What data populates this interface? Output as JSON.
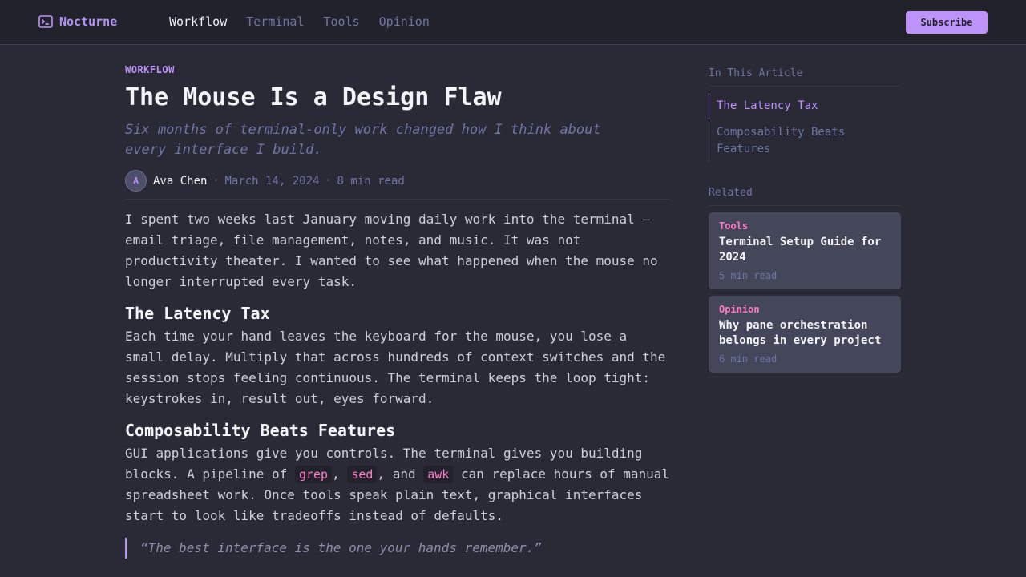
{
  "brand": {
    "name": "Nocturne",
    "icon": "terminal-icon"
  },
  "nav": [
    {
      "label": "Workflow",
      "active": true
    },
    {
      "label": "Terminal",
      "active": false
    },
    {
      "label": "Tools",
      "active": false
    },
    {
      "label": "Opinion",
      "active": false
    }
  ],
  "subscribe_label": "Subscribe",
  "article": {
    "kicker": "WORKFLOW",
    "title": "The Mouse Is a Design Flaw",
    "subtitle": "Six months of terminal-only work changed how I think about every interface I build.",
    "author": {
      "initial": "A",
      "name": "Ava Chen"
    },
    "date": "March 14, 2024",
    "read_time": "8 min read",
    "intro": "I spent two weeks last January moving daily work into the terminal — email triage, file management, notes, and music. It was not productivity theater. I wanted to see what happened when the mouse no longer interrupted every task.",
    "section1": {
      "heading": "The Latency Tax",
      "body": "Each time your hand leaves the keyboard for the mouse, you lose a small delay. Multiply that across hundreds of context switches and the session stops feeling continuous. The terminal keeps the loop tight: keystrokes in, result out, eyes forward."
    },
    "section2": {
      "heading": "Composability Beats Features",
      "body_before": "GUI applications give you controls. The terminal gives you building blocks. A pipeline of",
      "code1": "grep",
      "sep1": ",",
      "code2": "sed",
      "sep2": ", and",
      "code3": "awk",
      "body_after": "can replace hours of manual spreadsheet work. Once tools speak plain text, graphical interfaces start to look like tradeoffs instead of defaults."
    },
    "quote": "“The best interface is the one your hands remember.”"
  },
  "sidebar": {
    "toc_heading": "In This Article",
    "toc": [
      {
        "label": "The Latency Tax",
        "active": true
      },
      {
        "label": "Composability Beats Features",
        "active": false
      }
    ],
    "related_heading": "Related",
    "related": [
      {
        "tag": "Tools",
        "title": "Terminal Setup Guide for 2024",
        "time": "5 min read"
      },
      {
        "tag": "Opinion",
        "title": "Why pane orchestration belongs in every project",
        "time": "6 min read"
      }
    ]
  },
  "colors": {
    "accent": "#bd93f9",
    "pink": "#ff79c6",
    "background": "#292a36"
  }
}
